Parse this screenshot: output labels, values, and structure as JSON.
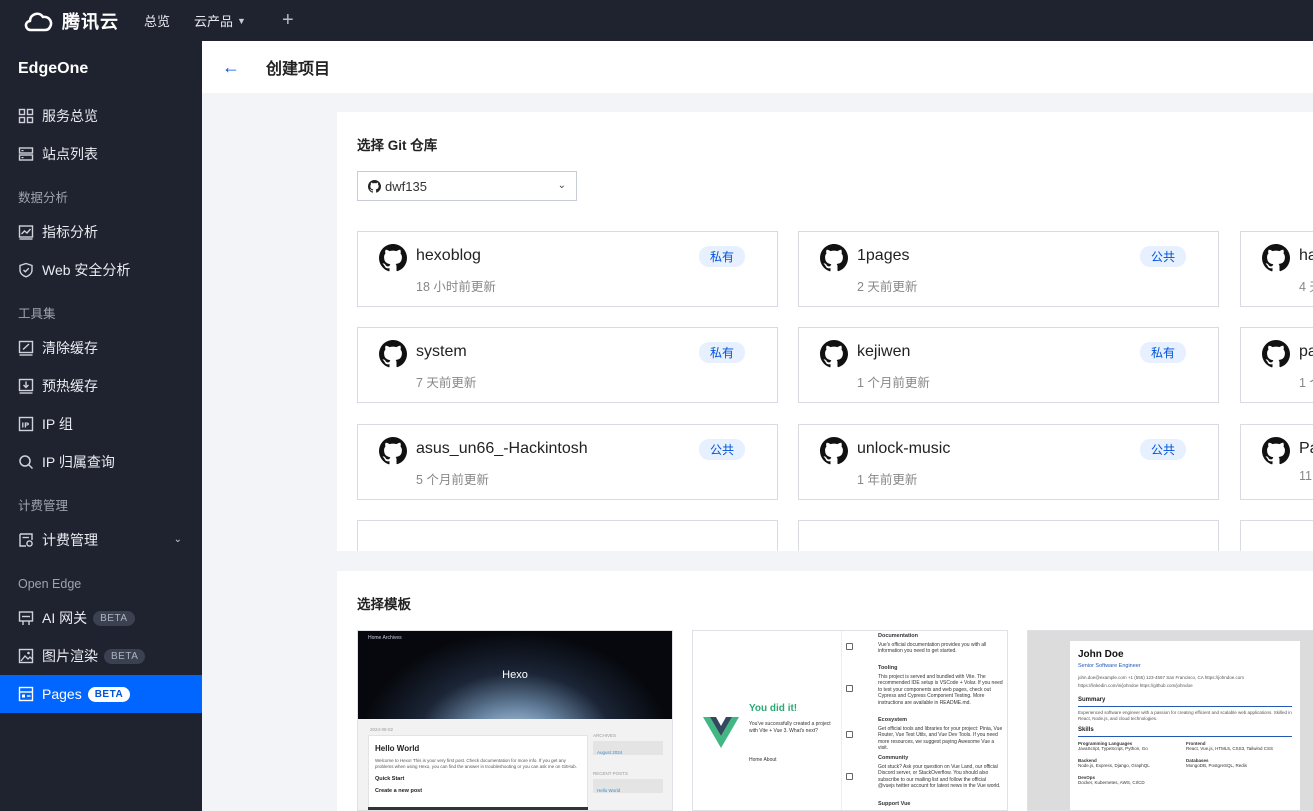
{
  "topbar": {
    "brand": "腾讯云",
    "nav": [
      {
        "label": "总览"
      },
      {
        "label": "云产品"
      }
    ],
    "plus": "+"
  },
  "sidebar": {
    "product": "EdgeOne",
    "groups": {
      "overview": [
        {
          "label": "服务总览",
          "icon": "grid-icon"
        },
        {
          "label": "站点列表",
          "icon": "server-list-icon"
        }
      ],
      "analytics_title": "数据分析",
      "analytics": [
        {
          "label": "指标分析",
          "icon": "chart-icon"
        },
        {
          "label": "Web 安全分析",
          "icon": "shield-icon"
        }
      ],
      "tools_title": "工具集",
      "tools": [
        {
          "label": "清除缓存",
          "icon": "clear-cache-icon"
        },
        {
          "label": "预热缓存",
          "icon": "download-icon"
        },
        {
          "label": "IP 组",
          "icon": "ip-icon"
        },
        {
          "label": "IP 归属查询",
          "icon": "search-icon"
        }
      ],
      "billing_title": "计费管理",
      "billing": [
        {
          "label": "计费管理",
          "icon": "billing-icon"
        }
      ],
      "openedge_title": "Open Edge",
      "openedge": [
        {
          "label": "AI 网关",
          "badge": "BETA",
          "icon": "gateway-icon"
        },
        {
          "label": "图片渲染",
          "badge": "BETA",
          "icon": "image-icon"
        },
        {
          "label": "Pages",
          "badge": "BETA",
          "icon": "pages-icon",
          "active": true
        }
      ]
    }
  },
  "header": {
    "back": "←",
    "title": "创建项目"
  },
  "git": {
    "title": "选择 Git 仓库",
    "account": "dwf135",
    "repos": [
      {
        "name": "hexoblog",
        "updated": "18 小时前更新",
        "visibility": "私有"
      },
      {
        "name": "1pages",
        "updated": "2 天前更新",
        "visibility": "公共"
      },
      {
        "name": "ha",
        "updated": "4 天"
      },
      {
        "name": "system",
        "updated": "7 天前更新",
        "visibility": "私有"
      },
      {
        "name": "kejiwen",
        "updated": "1 个月前更新",
        "visibility": "私有"
      },
      {
        "name": "pa",
        "updated": "1 个"
      },
      {
        "name": "asus_un66_-Hackintosh",
        "updated": "5 个月前更新",
        "visibility": "公共"
      },
      {
        "name": "unlock-music",
        "updated": "1 年前更新",
        "visibility": "公共"
      },
      {
        "name": "Pa",
        "updated": "11"
      }
    ]
  },
  "templates": {
    "title": "选择模板",
    "hexo": {
      "nav": "Home    Archives",
      "title": "Hexo",
      "date": "2024-08-02",
      "post_title": "Hello World",
      "post_text": "Welcome to Hexo! This is your very first post. Check documentation for more info. If you get any problems when using Hexo, you can find the answer in troubleshooting or you can ask me on GitHub.",
      "quick_start": "Quick Start",
      "create_post": "Create a new post",
      "archives": "ARCHIVES",
      "archive_item": "August 2024",
      "recent": "RECENT POSTS",
      "recent_item": "Hello World"
    },
    "vue": {
      "did": "You did it!",
      "text": "You've successfully created a project with Vite + Vue 3. What's next?",
      "links": "Home     About",
      "sections": [
        {
          "title": "Documentation",
          "text": "Vue's official documentation provides you with all information you need to get started."
        },
        {
          "title": "Tooling",
          "text": "This project is served and bundled with Vite. The recommended IDE setup is VSCode + Volar. If you need to test your components and web pages, check out Cypress and Cypress Component Testing. More instructions are available in README.md."
        },
        {
          "title": "Ecosystem",
          "text": "Get official tools and libraries for your project: Pinia, Vue Router, Vue Test Utils, and Vue Dev Tools. If you need more resources, we suggest paying Awesome Vue a visit."
        },
        {
          "title": "Community",
          "text": "Got stuck? Ask your question on Vue Land, our official Discord server, or StackOverflow. You should also subscribe to our mailing list and follow the official @vuejs twitter account for latest news in the Vue world."
        },
        {
          "title": "Support Vue",
          "text": ""
        }
      ]
    },
    "resume": {
      "name": "John Doe",
      "role": "Senior Software Engineer",
      "contact1": "john.doe@example.com    +1 (555) 123-4567    San Francisco, CA    https://johndoe.com",
      "contact2": "https://linkedin.com/in/johndoe    https://github.com/johndoe",
      "summary_title": "Summary",
      "summary": "Experienced software engineer with a passion for creating efficient and scalable web applications. Skilled in React, Node.js, and cloud technologies.",
      "skills_title": "Skills",
      "skills": [
        {
          "title": "Programming Languages",
          "value": "JavaScript, TypeScript, Python, Go"
        },
        {
          "title": "Frontend",
          "value": "React, Vue.js, HTML5, CSS3, Tailwind CSS"
        },
        {
          "title": "Backend",
          "value": "Node.js, Express, Django, GraphQL"
        },
        {
          "title": "Databases",
          "value": "MongoDB, PostgreSQL, Redis"
        },
        {
          "title": "DevOps",
          "value": "Docker, Kubernetes, AWS, CI/CD"
        }
      ]
    }
  },
  "colors": {
    "topbar": "#1f2330",
    "accent": "#0066ff",
    "tag_bg": "#e6f0ff",
    "tag_text": "#0052d9"
  }
}
